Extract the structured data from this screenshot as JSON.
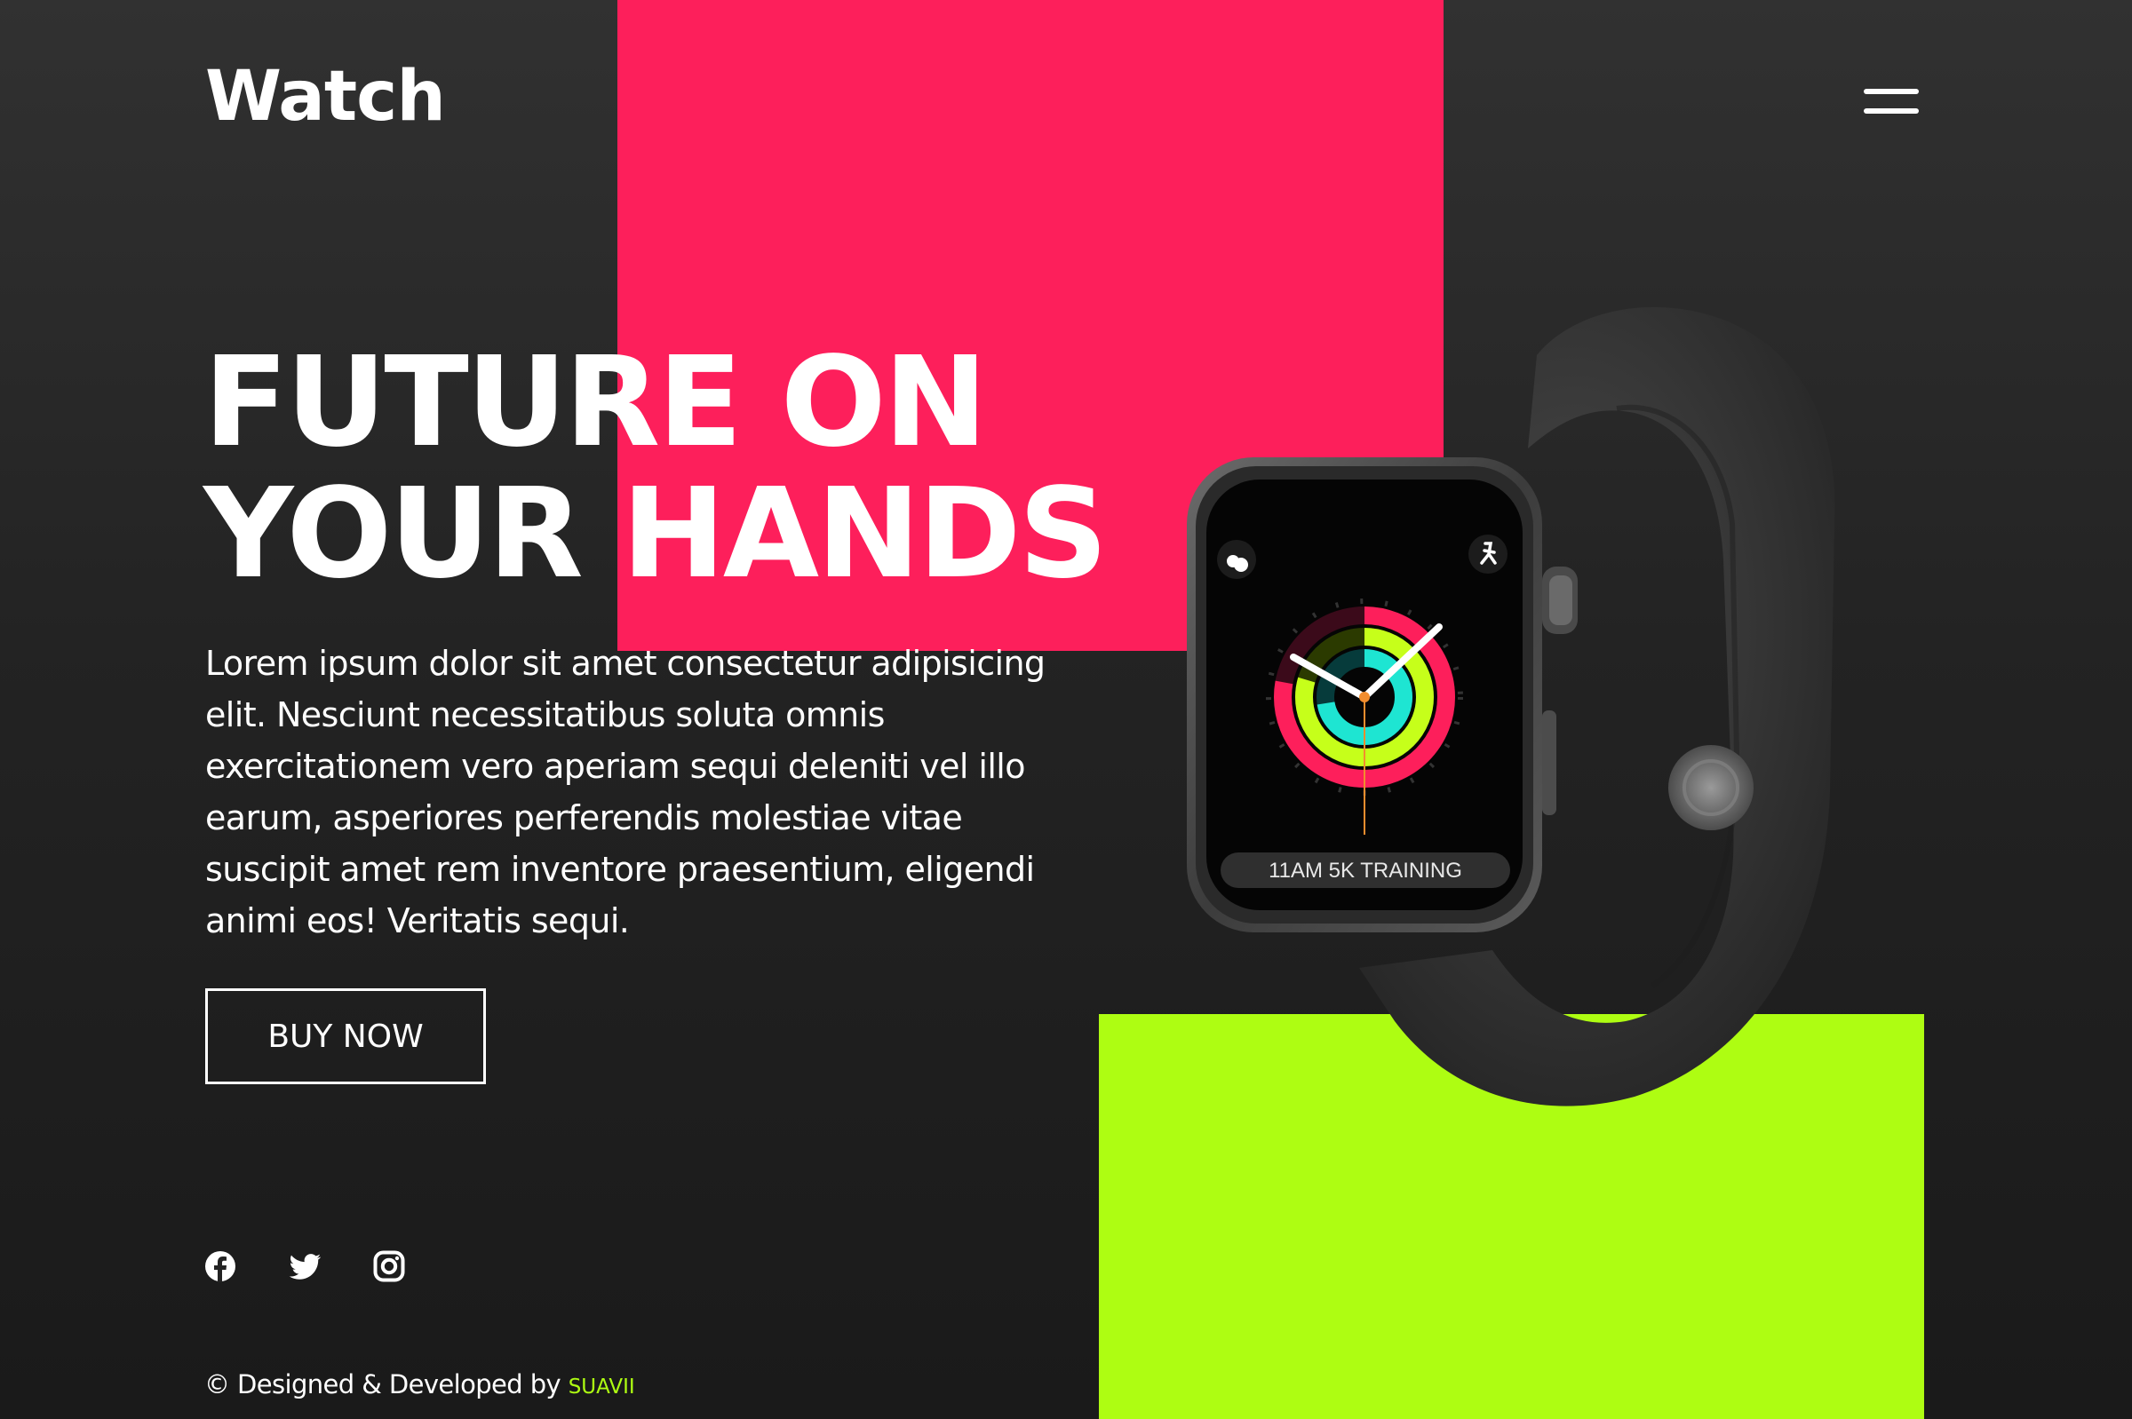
{
  "header": {
    "logo": "Watch",
    "menu_icon": "hamburger-menu-icon"
  },
  "hero": {
    "headline_line1": "FUTURE ON",
    "headline_line2": "YOUR HANDS",
    "description": "Lorem ipsum dolor sit amet consectetur adipisicing elit. Nesciunt necessitatibus soluta omnis exercitationem vero aperiam sequi deleniti vel illo earum, asperiores perferendis molestiae vitae suscipit amet rem inventore praesentium, eligendi animi eos! Veritatis sequi.",
    "cta_label": "BUY NOW"
  },
  "social": {
    "items": [
      {
        "icon": "facebook-icon"
      },
      {
        "icon": "twitter-icon"
      },
      {
        "icon": "instagram-icon"
      }
    ]
  },
  "footer": {
    "text": "© Designed & Developed by",
    "brand": "SUAVII"
  },
  "product": {
    "screen_label": "11AM 5K TRAINING"
  },
  "colors": {
    "background": "#262626",
    "accent_pink": "#fd1f5b",
    "accent_lime": "#aefd12",
    "text": "#ffffff"
  }
}
